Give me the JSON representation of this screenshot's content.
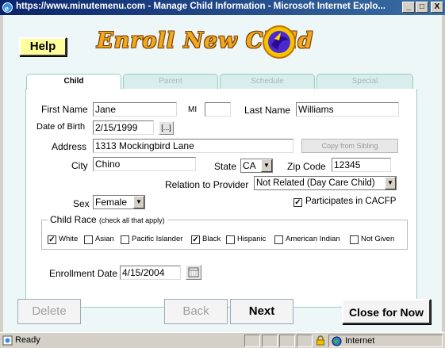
{
  "window": {
    "title": "https://www.minutemenu.com - Manage Child Information - Microsoft Internet Explo...",
    "minimize": "_",
    "maximize": "□",
    "close": "X"
  },
  "header": {
    "help_label": "Help",
    "logo_text": "Enroll New Child"
  },
  "tabs": [
    {
      "label": "Child",
      "active": true
    },
    {
      "label": "Parent",
      "active": false
    },
    {
      "label": "Schedule",
      "active": false
    },
    {
      "label": "Special",
      "active": false
    }
  ],
  "form": {
    "first_name_label": "First Name",
    "first_name_value": "Jane",
    "mi_label": "MI",
    "mi_value": "",
    "last_name_label": "Last Name",
    "last_name_value": "Williams",
    "dob_label": "Date of Birth",
    "dob_value": "2/15/1999",
    "dob_picker_label": "[...]",
    "address_label": "Address",
    "address_value": "1313 Mockingbird Lane",
    "copy_sibling_label": "Copy from Sibling",
    "city_label": "City",
    "city_value": "Chino",
    "state_label": "State",
    "state_value": "CA",
    "zip_label": "Zip Code",
    "zip_value": "12345",
    "relation_label": "Relation to Provider",
    "relation_value": "Not Related (Day Care Child)",
    "sex_label": "Sex",
    "sex_value": "Female",
    "cacfp_label": "Participates in CACFP",
    "cacfp_checked": true,
    "race_legend": "Child Race",
    "race_hint": "(check all that apply)",
    "races": [
      {
        "label": "White",
        "checked": true
      },
      {
        "label": "Asian",
        "checked": false
      },
      {
        "label": "Pacific Islander",
        "checked": false
      },
      {
        "label": "Black",
        "checked": true
      },
      {
        "label": "Hispanic",
        "checked": false
      },
      {
        "label": "American Indian",
        "checked": false
      },
      {
        "label": "Not Given",
        "checked": false
      }
    ],
    "enrollment_label": "Enrollment Date",
    "enrollment_value": "4/15/2004"
  },
  "nav": {
    "delete_label": "Delete",
    "back_label": "Back",
    "next_label": "Next",
    "close_label": "Close for Now"
  },
  "status": {
    "text": "Ready",
    "zone": "Internet"
  },
  "colors": {
    "title_bar": "#0a246a",
    "background": "#eef7f7",
    "help_button": "#ffff99",
    "logo": "#f0a820"
  }
}
